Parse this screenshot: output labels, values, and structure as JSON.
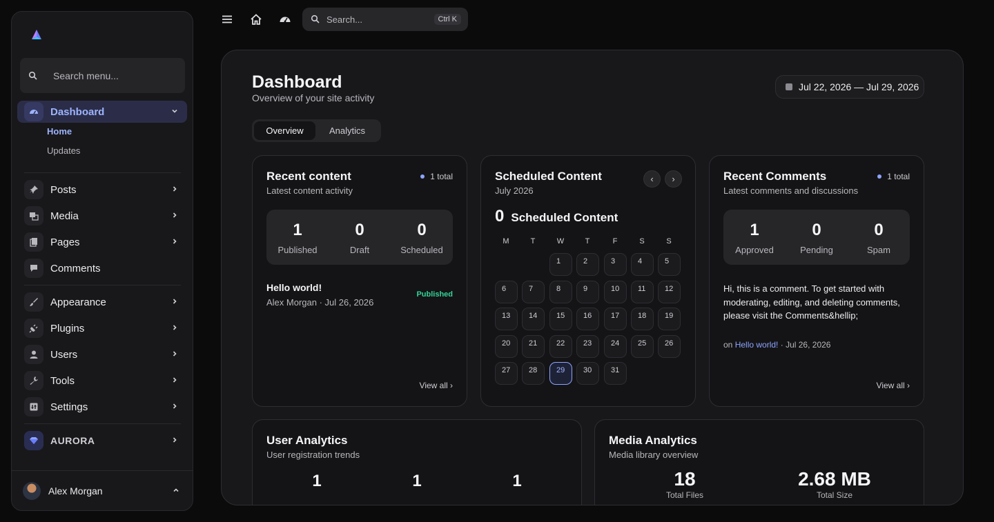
{
  "sidebar": {
    "search_placeholder": "Search menu...",
    "items": [
      {
        "label": "Dashboard"
      },
      {
        "label": "Posts"
      },
      {
        "label": "Media"
      },
      {
        "label": "Pages"
      },
      {
        "label": "Comments"
      },
      {
        "label": "Appearance"
      },
      {
        "label": "Plugins"
      },
      {
        "label": "Users"
      },
      {
        "label": "Tools"
      },
      {
        "label": "Settings"
      },
      {
        "label": "AURORA"
      }
    ],
    "sub_items": [
      "Home",
      "Updates"
    ],
    "user_name": "Alex Morgan"
  },
  "topbar": {
    "search_placeholder": "Search...",
    "shortcut": "Ctrl K"
  },
  "page": {
    "title": "Dashboard",
    "subtitle": "Overview of your site activity",
    "date_range": "Jul 22, 2026 — Jul 29, 2026",
    "tabs": [
      "Overview",
      "Analytics"
    ]
  },
  "recent_content": {
    "title": "Recent content",
    "subtitle": "Latest content activity",
    "badge": "1 total",
    "stats": [
      {
        "value": "1",
        "label": "Published"
      },
      {
        "value": "0",
        "label": "Draft"
      },
      {
        "value": "0",
        "label": "Scheduled"
      }
    ],
    "post_title": "Hello world!",
    "post_meta": "Alex Morgan · Jul 26, 2026",
    "post_status": "Published",
    "view_all": "View all ›"
  },
  "scheduled": {
    "title": "Scheduled Content",
    "subtitle": "July 2026",
    "count": "0",
    "count_label": "Scheduled Content",
    "prev": "‹",
    "next": "›",
    "weekdays": [
      "M",
      "T",
      "W",
      "T",
      "F",
      "S",
      "S"
    ],
    "days": [
      "1",
      "2",
      "3",
      "4",
      "5",
      "6",
      "7",
      "8",
      "9",
      "10",
      "11",
      "12",
      "13",
      "14",
      "15",
      "16",
      "17",
      "18",
      "19",
      "20",
      "21",
      "22",
      "23",
      "24",
      "25",
      "26",
      "27",
      "28",
      "29",
      "30",
      "31"
    ],
    "today": "29"
  },
  "recent_comments": {
    "title": "Recent Comments",
    "subtitle": "Latest comments and discussions",
    "badge": "1 total",
    "stats": [
      {
        "value": "1",
        "label": "Approved"
      },
      {
        "value": "0",
        "label": "Pending"
      },
      {
        "value": "0",
        "label": "Spam"
      }
    ],
    "comment": "Hi, this is a comment. To get started with moderating, editing, and deleting comments, please visit the Comments&hellip;",
    "meta_prefix": "on",
    "meta_link": "Hello world!",
    "meta_date": "· Jul 26, 2026",
    "view_all": "View all ›"
  },
  "user_analytics": {
    "title": "User Analytics",
    "subtitle": "User registration trends",
    "values": [
      "1",
      "1",
      "1"
    ]
  },
  "media_analytics": {
    "title": "Media Analytics",
    "subtitle": "Media library overview",
    "files_value": "18",
    "files_label": "Total Files",
    "size_value": "2.68 MB",
    "size_label": "Total Size"
  },
  "colors": {
    "accent": "#8da4ff",
    "success": "#34d399",
    "background": "#0b0b0c",
    "surface": "#18181b"
  }
}
